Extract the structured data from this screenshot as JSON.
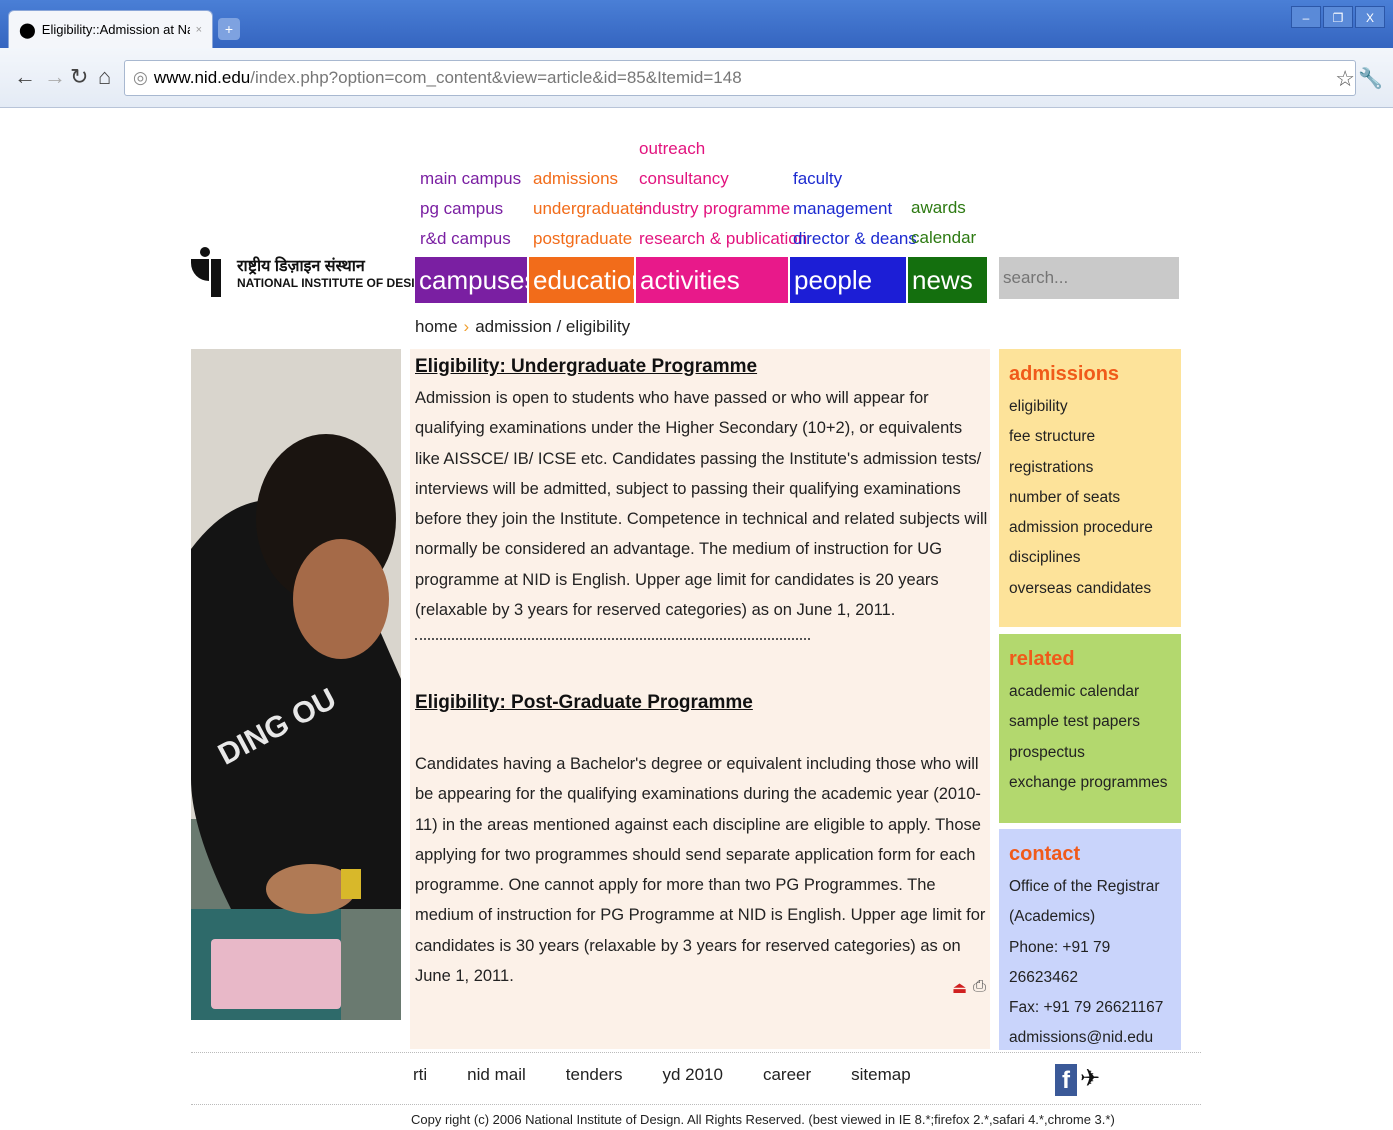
{
  "browser": {
    "tab_title": "Eligibility::Admission at Nati...",
    "tab_close": "×",
    "new_tab": "+",
    "min": "–",
    "restore": "❐",
    "close": "X",
    "url_host": "www.nid.edu",
    "url_path": "/index.php?option=com_content&view=article&id=85&Itemid=148"
  },
  "logo": {
    "hindi": "राष्ट्रीय डिज़ाइन संस्थान",
    "english": "NATIONAL INSTITUTE OF DESIGN"
  },
  "menus": {
    "campuses": [
      "main campus",
      "pg campus",
      "r&d campus"
    ],
    "education": [
      "admissions",
      "undergraduate",
      "postgraduate"
    ],
    "activities": [
      "outreach",
      "consultancy",
      "industry programme",
      "research & publication"
    ],
    "people": [
      "faculty",
      "management",
      "director & deans"
    ],
    "news": [
      "awards",
      "calendar"
    ]
  },
  "navbar": {
    "campuses": "campuses",
    "education": "education",
    "activities": "activities",
    "people": "people",
    "news": "news"
  },
  "search": {
    "placeholder": "search..."
  },
  "breadcrumb": {
    "home": "home",
    "sep": "›",
    "current": "admission / eligibility"
  },
  "article": {
    "ug_heading": "Eligibility: Undergraduate Programme",
    "ug_text": "Admission is open to students who have passed or who will appear for qualifying examinations under the Higher Secondary (10+2), or equivalents like AISSCE/ IB/ ICSE etc. Candidates passing the Institute's admission tests/ interviews will be admitted, subject to passing their qualifying examinations before they join the Institute. Competence in technical and related subjects will normally be considered an advantage. The medium of instruction for UG programme at NID is English. Upper age limit for candidates is 20 years (relaxable by 3 years for reserved categories) as on June 1, 2011.",
    "pg_heading": "Eligibility: Post-Graduate Programme",
    "pg_text": "Candidates having a Bachelor's degree or equivalent including those who will be appearing for the qualifying examinations during the academic year (2010-11) in the areas mentioned against each discipline are eligible to apply. Those applying for two programmes should send separate application form for each programme. One cannot apply for more than two PG Programmes. The medium of instruction for PG Programme at NID is English. Upper age limit for candidates is 30 years (relaxable by 3 years for reserved categories) as on June 1, 2011."
  },
  "sidebar": {
    "admissions": {
      "title": "admissions",
      "items": [
        "eligibility",
        "fee structure",
        "registrations",
        "number of seats",
        "admission procedure",
        "disciplines",
        "overseas candidates"
      ]
    },
    "related": {
      "title": "related",
      "items": [
        "academic calendar",
        "sample test papers",
        "prospectus",
        "exchange programmes"
      ]
    },
    "contact": {
      "title": "contact",
      "items": [
        "Office of the Registrar",
        "(Academics)",
        "Phone: +91 79 26623462",
        "Fax: +91 79 26621167",
        "admissions@nid.edu"
      ]
    }
  },
  "colors": {
    "campuses": "#7a1fa2",
    "education": "#f26c1a",
    "activities": "#e8198a",
    "people": "#1c1ed6",
    "news": "#146f0e",
    "admissions_bg": "#fde39a",
    "related_bg": "#b3d86e",
    "contact_bg": "#c9d4fb"
  },
  "footer": {
    "links": [
      "rti",
      "nid mail",
      "tenders",
      "yd 2010",
      "career",
      "sitemap"
    ],
    "fb": "f",
    "copyright": "Copy right (c) 2006 National Institute of Design. All Rights Reserved. (best viewed in IE 8.*;firefox 2.*,safari 4.*,chrome 3.*)"
  }
}
